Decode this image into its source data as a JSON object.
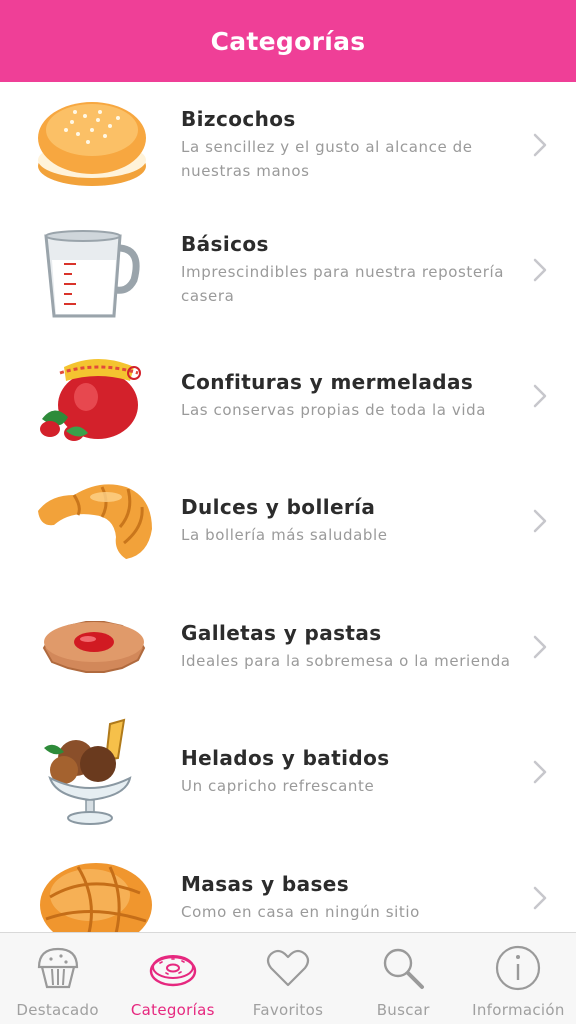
{
  "header": {
    "title": "Categorías"
  },
  "categories": [
    {
      "icon": "cake-icon",
      "title": "Bizcochos",
      "subtitle": "La sencillez y el gusto al alcance de nuestras manos"
    },
    {
      "icon": "measuring-jug-icon",
      "title": "Básicos",
      "subtitle": "Imprescindibles para nuestra repostería casera"
    },
    {
      "icon": "jam-jar-icon",
      "title": "Confituras y mermeladas",
      "subtitle": "Las conservas propias de toda la vida"
    },
    {
      "icon": "croissant-icon",
      "title": "Dulces y bollería",
      "subtitle": "La bollería más saludable"
    },
    {
      "icon": "cookie-icon",
      "title": "Galletas y pastas",
      "subtitle": "Ideales para la sobremesa o la merienda"
    },
    {
      "icon": "ice-cream-icon",
      "title": "Helados y batidos",
      "subtitle": "Un capricho refrescante"
    },
    {
      "icon": "bread-bun-icon",
      "title": "Masas y bases",
      "subtitle": "Como en casa en ningún sitio"
    }
  ],
  "tabs": [
    {
      "icon": "muffin-icon",
      "label": "Destacado",
      "active": false
    },
    {
      "icon": "donut-icon",
      "label": "Categorías",
      "active": true
    },
    {
      "icon": "heart-icon",
      "label": "Favoritos",
      "active": false
    },
    {
      "icon": "magnifier-icon",
      "label": "Buscar",
      "active": false
    },
    {
      "icon": "info-icon",
      "label": "Información",
      "active": false
    }
  ],
  "colors": {
    "accent": "#ef3f97",
    "active_tab": "#e6287f",
    "inactive_tab": "#a0a0a0"
  }
}
